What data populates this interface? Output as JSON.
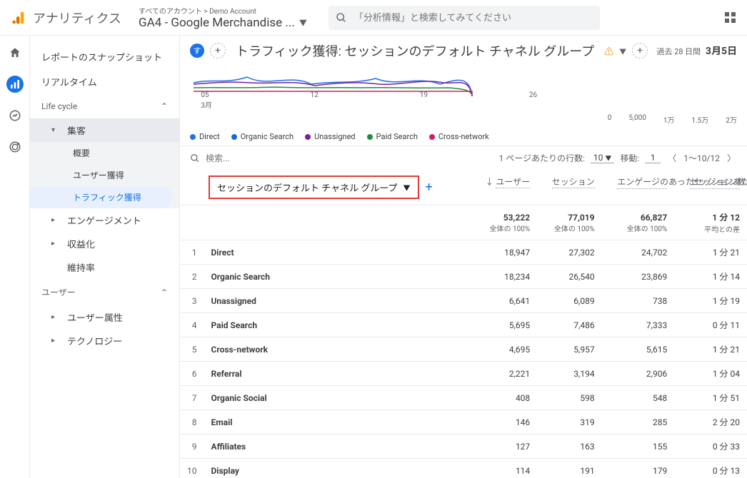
{
  "app_title": "アナリティクス",
  "account_breadcrumb": "すべてのアカウント > Demo Account",
  "property_name": "GA4 - Google Merchandise ...",
  "search_placeholder": "「分析情報」と検索してみてください",
  "sidebar": {
    "snapshot": "レポートのスナップショット",
    "realtime": "リアルタイム",
    "lifecycle_label": "Life cycle",
    "acq": "集客",
    "acq_children": {
      "overview": "概要",
      "user_acq": "ユーザー獲得",
      "traffic_acq": "トラフィック獲得"
    },
    "engagement": "エンゲージメント",
    "monetization": "収益化",
    "retention": "維持率",
    "user_label": "ユーザー",
    "user_attr": "ユーザー属性",
    "tech": "テクノロジー"
  },
  "report": {
    "title": "トラフィック獲得: セッションのデフォルト チャネル グループ",
    "chip": "す",
    "date_label": "過去 28 日間",
    "date_value": "3月5日"
  },
  "chart_data": {
    "type": "line",
    "x_ticks": [
      {
        "label": "05",
        "sub": "3月",
        "pos": 2
      },
      {
        "label": "12",
        "pos": 22
      },
      {
        "label": "19",
        "pos": 42
      },
      {
        "label": "26",
        "pos": 62
      }
    ],
    "right_axis": [
      "0",
      "5,000",
      "1万",
      "1.5万",
      "2万"
    ],
    "series": [
      {
        "name": "Direct",
        "color": "#1a73e8"
      },
      {
        "name": "Organic Search",
        "color": "#1967d2"
      },
      {
        "name": "Unassigned",
        "color": "#7b1fa2"
      },
      {
        "name": "Paid Search",
        "color": "#1e8e3e"
      },
      {
        "name": "Cross-network",
        "color": "#d81b60"
      }
    ]
  },
  "table_ctrl": {
    "search_placeholder": "検索...",
    "rows_label": "1 ページあたりの行数:",
    "rows_value": "10",
    "goto_label": "移動:",
    "goto_value": "1",
    "range": "1～10/12"
  },
  "table": {
    "dim_header": "セッションのデフォルト チャネル グループ",
    "cols": [
      {
        "name": "ユーザー",
        "arrow": true
      },
      {
        "name": "セッション"
      },
      {
        "name": "エンゲージのあったセッション数"
      },
      {
        "name": "セッションあたりの平均エンゲージメント"
      }
    ],
    "total": {
      "users": "53,222",
      "sessions": "77,019",
      "engaged": "66,827",
      "avg": "1 分 12",
      "sub1": "全体の 100%",
      "sub2": "全体の 100%",
      "sub3": "全体の 100%",
      "sub4": "平均との差"
    },
    "rows": [
      {
        "i": "1",
        "dim": "Direct",
        "users": "18,947",
        "sessions": "27,302",
        "engaged": "24,702",
        "avg": "1 分 21"
      },
      {
        "i": "2",
        "dim": "Organic Search",
        "users": "18,234",
        "sessions": "26,540",
        "engaged": "23,869",
        "avg": "1 分 14"
      },
      {
        "i": "3",
        "dim": "Unassigned",
        "users": "6,641",
        "sessions": "6,089",
        "engaged": "738",
        "avg": "1 分 19"
      },
      {
        "i": "4",
        "dim": "Paid Search",
        "users": "5,695",
        "sessions": "7,486",
        "engaged": "7,333",
        "avg": "0 分 11"
      },
      {
        "i": "5",
        "dim": "Cross-network",
        "users": "4,695",
        "sessions": "5,957",
        "engaged": "5,615",
        "avg": "1 分 21"
      },
      {
        "i": "6",
        "dim": "Referral",
        "users": "2,221",
        "sessions": "3,194",
        "engaged": "2,906",
        "avg": "1 分 04"
      },
      {
        "i": "7",
        "dim": "Organic Social",
        "users": "408",
        "sessions": "598",
        "engaged": "548",
        "avg": "1 分 51"
      },
      {
        "i": "8",
        "dim": "Email",
        "users": "146",
        "sessions": "319",
        "engaged": "285",
        "avg": "2 分 20"
      },
      {
        "i": "9",
        "dim": "Affiliates",
        "users": "127",
        "sessions": "163",
        "engaged": "155",
        "avg": "0 分 33"
      },
      {
        "i": "10",
        "dim": "Display",
        "users": "114",
        "sessions": "191",
        "engaged": "179",
        "avg": "0 分 13"
      }
    ]
  }
}
